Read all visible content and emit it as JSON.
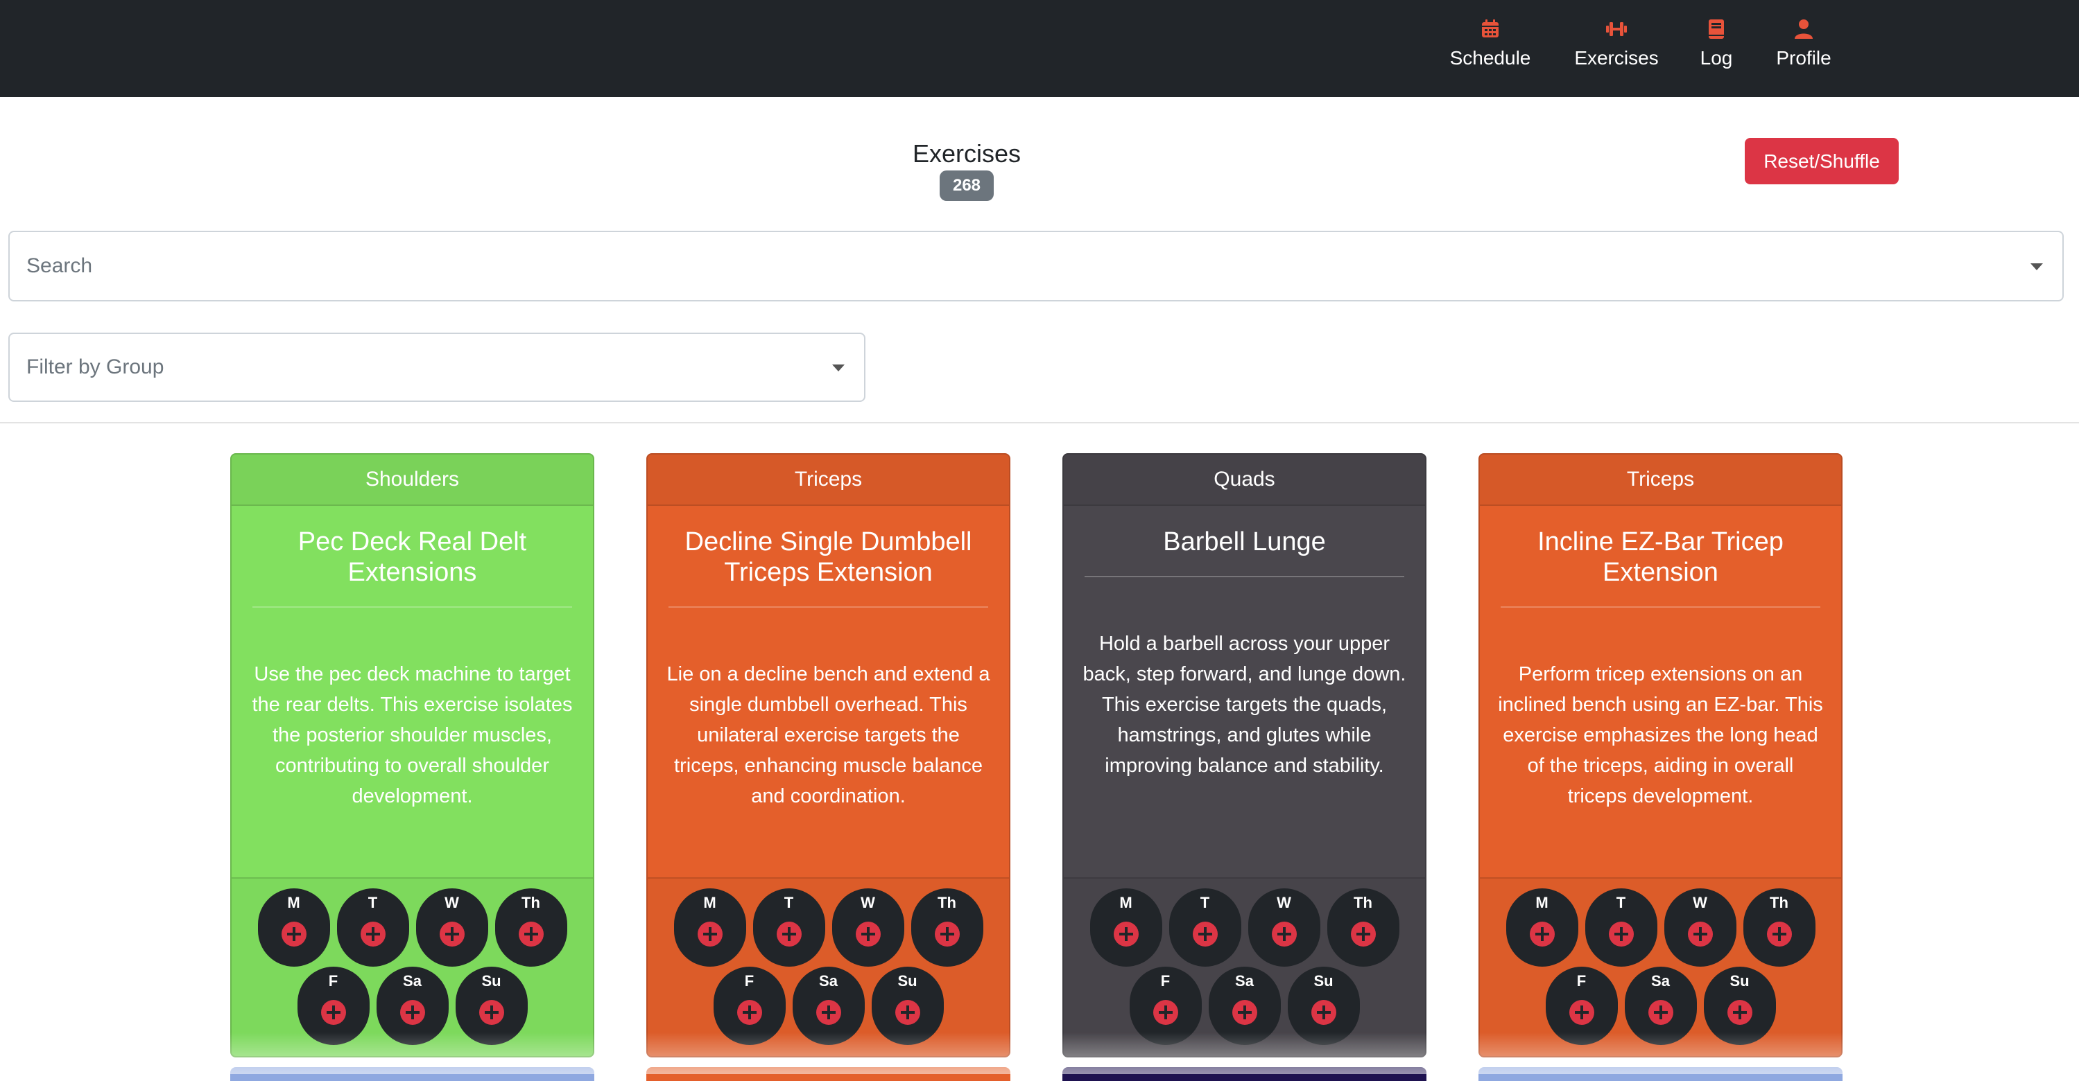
{
  "nav": {
    "items": [
      {
        "label": "Schedule",
        "icon": "calendar-icon"
      },
      {
        "label": "Exercises",
        "icon": "dumbbell-icon"
      },
      {
        "label": "Log",
        "icon": "book-icon"
      },
      {
        "label": "Profile",
        "icon": "user-icon"
      }
    ],
    "accent_color": "#e8533a"
  },
  "header": {
    "title": "Exercises",
    "count": "268",
    "reset_label": "Reset/Shuffle"
  },
  "search": {
    "placeholder": "Search"
  },
  "filter": {
    "placeholder": "Filter by Group"
  },
  "cards": [
    {
      "group": "Shoulders",
      "title": "Pec Deck Real Delt Extensions",
      "description": "Use the pec deck machine to target the rear delts. This exercise isolates the posterior shoulder muscles, contributing to overall shoulder development.",
      "color": "#82e05f"
    },
    {
      "group": "Triceps",
      "title": "Decline Single Dumbbell Triceps Extension",
      "description": "Lie on a decline bench and extend a single dumbbell overhead. This unilateral exercise targets the triceps, enhancing muscle balance and coordination.",
      "color": "#e45f2b"
    },
    {
      "group": "Quads",
      "title": "Barbell Lunge",
      "description": "Hold a barbell across your upper back, step forward, and lunge down. This exercise targets the quads, hamstrings, and glutes while improving balance and stability.",
      "color": "#4a474d"
    },
    {
      "group": "Triceps",
      "title": "Incline EZ-Bar Tricep Extension",
      "description": "Perform tricep extensions on an inclined bench using an EZ-bar. This exercise emphasizes the long head of the triceps, aiding in overall triceps development.",
      "color": "#e45f2b"
    }
  ],
  "days": [
    "M",
    "T",
    "W",
    "Th",
    "F",
    "Sa",
    "Su"
  ],
  "next_row_colors": [
    "#8fa8e0",
    "#e45f2b",
    "#1e1250",
    "#8fa8e0"
  ]
}
